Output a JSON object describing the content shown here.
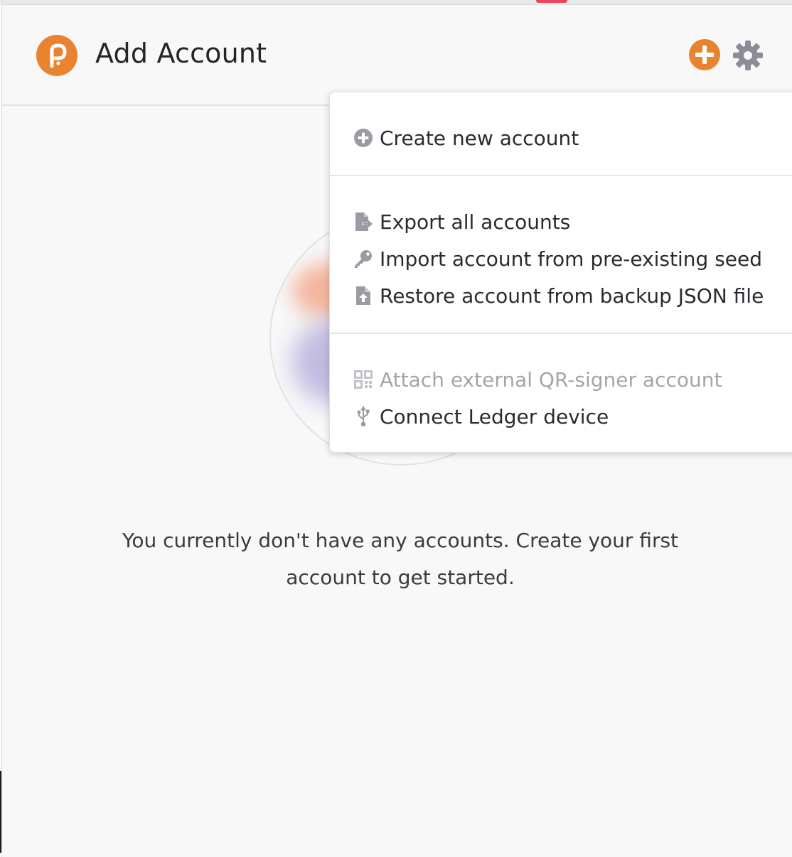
{
  "header": {
    "title": "Add Account"
  },
  "menu": {
    "create_new_account": "Create new account",
    "export_all_accounts": "Export all accounts",
    "import_from_seed": "Import account from pre-existing seed",
    "restore_from_json": "Restore account from backup JSON file",
    "attach_qr_signer": "Attach external QR-signer account",
    "connect_ledger": "Connect Ledger device"
  },
  "empty_state": {
    "message_line1": "You currently don't have any accounts. Create your first",
    "message_line2": "account to get started."
  },
  "colors": {
    "accent": "#e8842f",
    "icon_gray": "#9a9ba3",
    "text": "#242529",
    "disabled_text": "#a4a5ab"
  },
  "icons": {
    "logo": "polkadot-p-logo",
    "add": "plus-circle-icon",
    "settings": "gear-icon",
    "create": "plus-circle-icon",
    "export": "file-export-icon",
    "import_seed": "key-icon",
    "restore_json": "file-upload-icon",
    "qr_signer": "qrcode-icon",
    "ledger": "usb-icon"
  }
}
